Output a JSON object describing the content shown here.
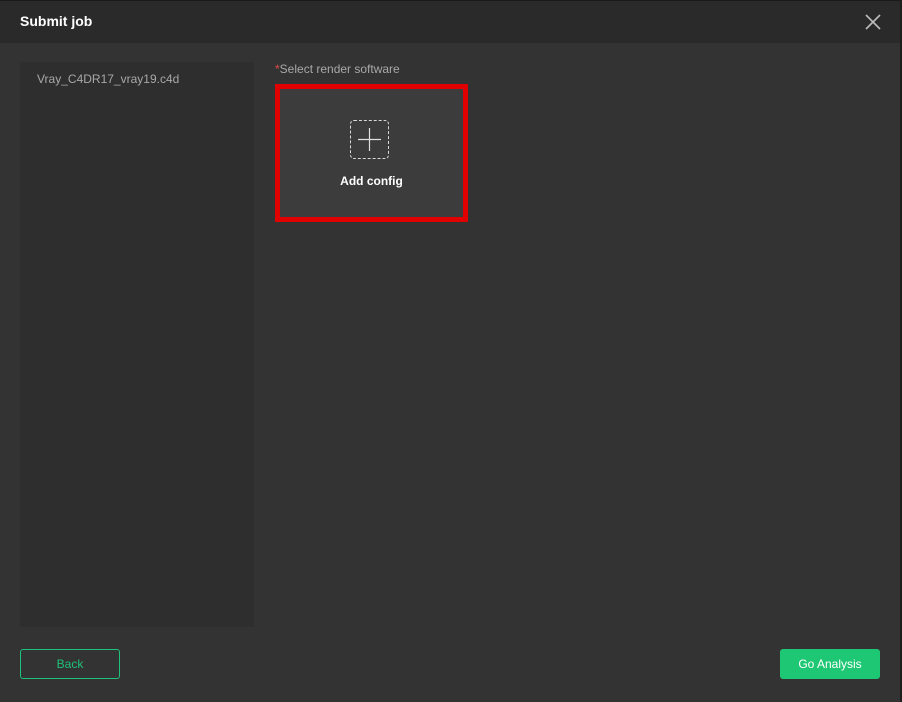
{
  "dialog": {
    "title": "Submit job",
    "close_icon": "close-icon"
  },
  "file_panel": {
    "items": [
      {
        "label": "Vray_C4DR17_vray19.c4d"
      }
    ]
  },
  "software": {
    "required_mark": "*",
    "label": "Select render software",
    "add_config_label": "Add config",
    "add_icon": "plus-icon",
    "highlight_color": "#e00000"
  },
  "footer": {
    "back_label": "Back",
    "go_label": "Go Analysis",
    "accent_color": "#1ec773"
  }
}
